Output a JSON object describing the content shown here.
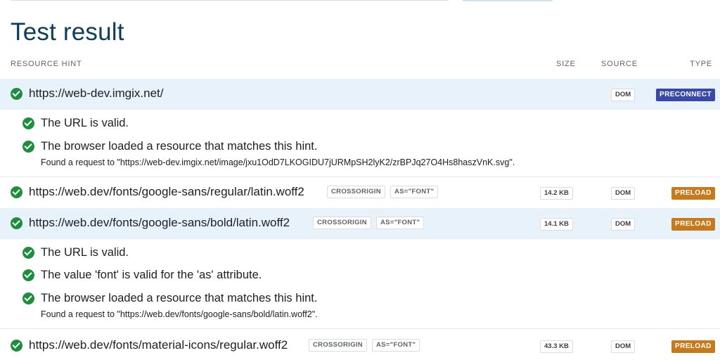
{
  "page": {
    "title": "Test result"
  },
  "columns": {
    "resource_hint": "RESOURCE HINT",
    "size": "SIZE",
    "source": "SOURCE",
    "type": "TYPE"
  },
  "colors": {
    "check": "#1e8e3e",
    "preconnect": "#3949ab",
    "preload": "#c77a1c",
    "selected_row": "#e8f2fb",
    "title": "#0b3d5c"
  },
  "rows": [
    {
      "url": "https://web-dev.imgix.net/",
      "size": "",
      "source": "DOM",
      "type": "PRECONNECT",
      "tags": [],
      "details": [
        "The URL is valid.",
        "The browser loaded a resource that matches this hint."
      ],
      "found": "Found a request to \"https://web-dev.imgix.net/image/jxu1OdD7LKOGIDU7jURMpSH2lyK2/zrBPJq27O4Hs8haszVnK.svg\"."
    },
    {
      "url": "https://web.dev/fonts/google-sans/regular/latin.woff2",
      "size": "14.2 KB",
      "source": "DOM",
      "type": "PRELOAD",
      "tags": [
        "CROSSORIGIN",
        "AS=\"FONT\""
      ]
    },
    {
      "url": "https://web.dev/fonts/google-sans/bold/latin.woff2",
      "size": "14.1 KB",
      "source": "DOM",
      "type": "PRELOAD",
      "tags": [
        "CROSSORIGIN",
        "AS=\"FONT\""
      ],
      "details": [
        "The URL is valid.",
        "The value 'font' is valid for the 'as' attribute.",
        "The browser loaded a resource that matches this hint."
      ],
      "found": "Found a request to \"https://web.dev/fonts/google-sans/bold/latin.woff2\"."
    },
    {
      "url": "https://web.dev/fonts/material-icons/regular.woff2",
      "size": "43.3 KB",
      "source": "DOM",
      "type": "PRELOAD",
      "tags": [
        "CROSSORIGIN",
        "AS=\"FONT\""
      ]
    }
  ]
}
